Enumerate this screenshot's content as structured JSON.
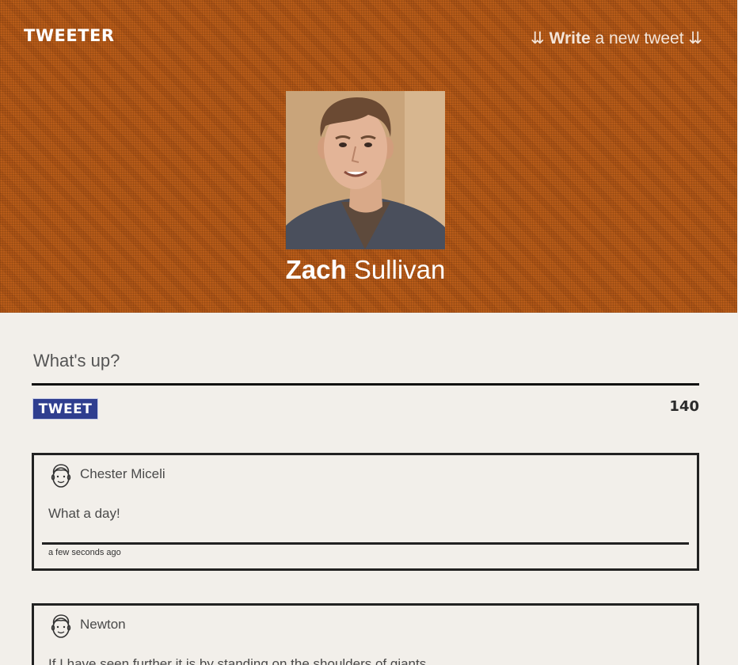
{
  "header": {
    "logo": "TWEETER",
    "compose_link": {
      "prefix_arrows": "⇊",
      "strong": "Write",
      "rest": "a new tweet",
      "suffix_arrows": "⇊"
    },
    "background_color": "#b85b18"
  },
  "profile": {
    "first_name": "Zach",
    "last_name": "Sullivan",
    "avatar": "profile-photo"
  },
  "composer": {
    "placeholder": "What's up?",
    "value": "",
    "tweet_button_label": "TWEET",
    "char_count": "140",
    "button_color": "#2f3e8f"
  },
  "tweets": [
    {
      "author": "Chester Miceli",
      "avatar_icon": "cartoon-face-icon",
      "content": "What a day!",
      "timestamp": "a few seconds ago"
    },
    {
      "author": "Newton",
      "avatar_icon": "cartoon-face-icon",
      "content": "If I have seen further it is by standing on the shoulders of giants"
    }
  ],
  "colors": {
    "page_background": "#f2efea",
    "text": "#4a4a4a",
    "border": "#222222"
  }
}
